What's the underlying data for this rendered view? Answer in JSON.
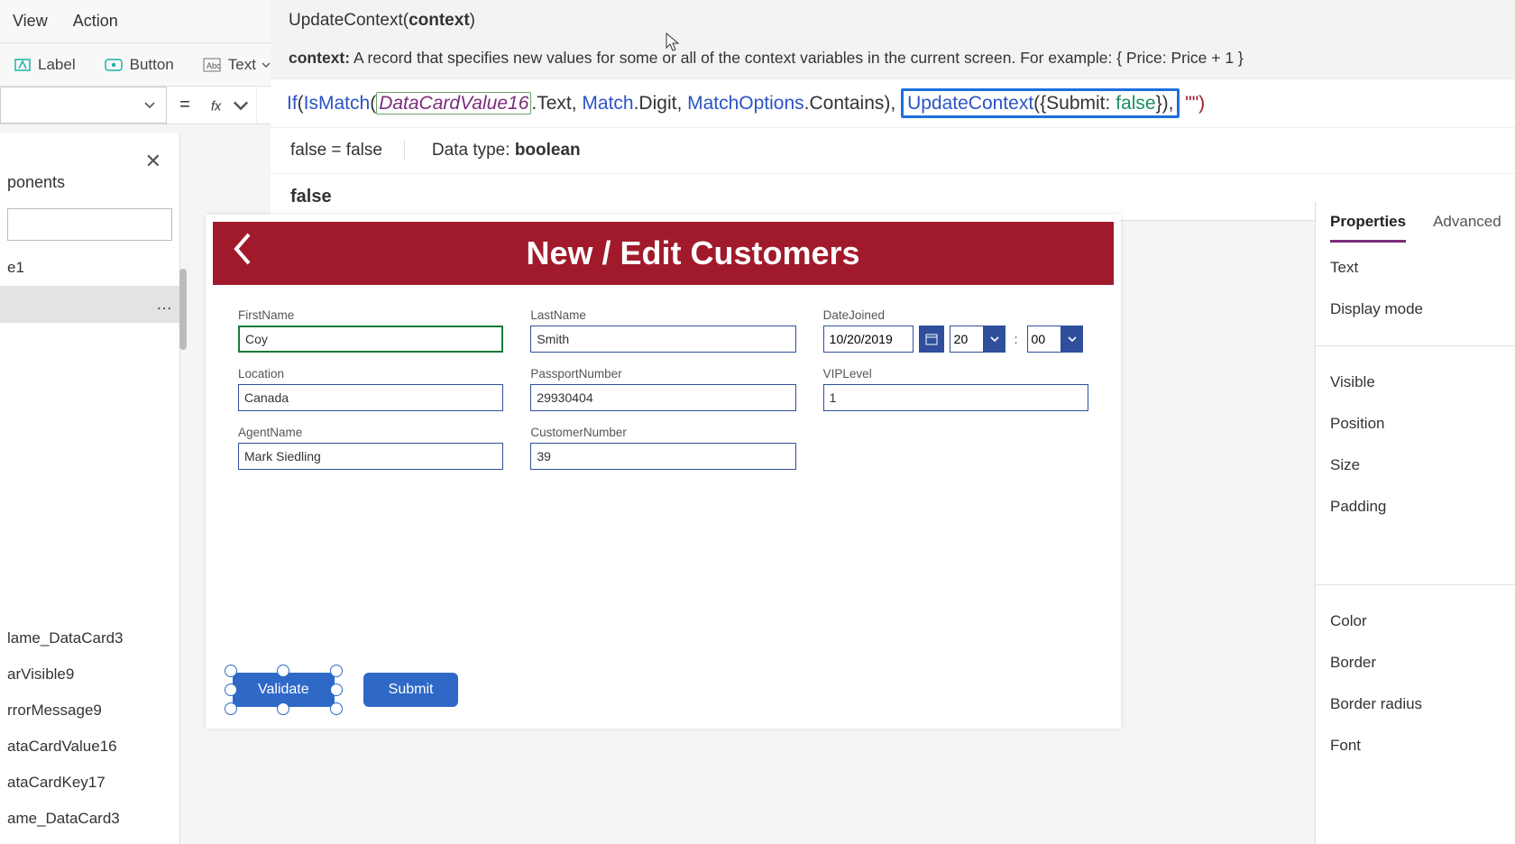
{
  "menu": {
    "view": "View",
    "action": "Action"
  },
  "insert": {
    "label": "Label",
    "button": "Button",
    "text": "Text"
  },
  "formula_help": {
    "signature_fn": "UpdateContext(",
    "signature_param": "context",
    "signature_close": ")",
    "desc_label": "context:",
    "desc_text": "A record that specifies new values for some or all of the context variables in the current screen. For example: { Price: Price + 1 }"
  },
  "formula": {
    "pre": "If",
    "open": "(",
    "fn1": "IsMatch",
    "open2": "(",
    "var1": "DataCardValue16",
    "dot_text": ".Text, ",
    "match": "Match",
    "dot_digit": ".Digit, ",
    "matchopt": "MatchOptions",
    "dot_contains": ".Contains), ",
    "boxed_fn": "UpdateContext",
    "boxed_record": "({Submit: ",
    "boxed_val": "false",
    "boxed_close": "}),",
    "tail": " \"\")"
  },
  "result": {
    "eq": "false  =  false",
    "datatype_label": "Data type: ",
    "datatype_val": "boolean",
    "value": "false"
  },
  "symbols": {
    "equals": "=",
    "dots": "…",
    "close": "✕",
    "colon": ":"
  },
  "tree": {
    "tab": "ponents",
    "item1": "e1",
    "sub1": "lame_DataCard3",
    "sub2": "arVisible9",
    "sub3": "rrorMessage9",
    "sub4": "ataCardValue16",
    "sub5": "ataCardKey17",
    "sub6": "ame_DataCard3"
  },
  "canvas": {
    "title": "New / Edit Customers",
    "fields": {
      "FirstName": {
        "label": "FirstName",
        "value": "Coy"
      },
      "LastName": {
        "label": "LastName",
        "value": "Smith"
      },
      "DateJoined": {
        "label": "DateJoined",
        "date": "10/20/2019",
        "hh": "20",
        "mm": "00"
      },
      "Location": {
        "label": "Location",
        "value": "Canada"
      },
      "PassportNumber": {
        "label": "PassportNumber",
        "value": "29930404"
      },
      "VIPLevel": {
        "label": "VIPLevel",
        "value": "1"
      },
      "AgentName": {
        "label": "AgentName",
        "value": "Mark Siedling"
      },
      "CustomerNumber": {
        "label": "CustomerNumber",
        "value": "39"
      }
    },
    "buttons": {
      "validate": "Validate",
      "submit": "Submit"
    }
  },
  "props": {
    "tab_properties": "Properties",
    "tab_advanced": "Advanced",
    "rows": {
      "text": "Text",
      "display_mode": "Display mode",
      "visible": "Visible",
      "position": "Position",
      "size": "Size",
      "padding": "Padding",
      "color": "Color",
      "border": "Border",
      "border_radius": "Border radius",
      "font": "Font"
    }
  }
}
